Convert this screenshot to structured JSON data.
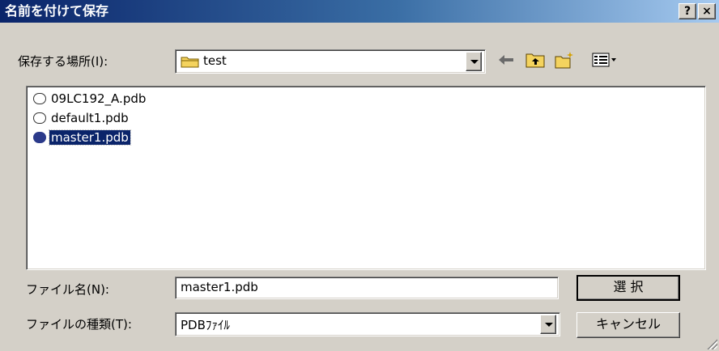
{
  "window": {
    "title": "名前を付けて保存",
    "help_label": "?",
    "close_label": "×"
  },
  "location": {
    "label": "保存する場所(I):",
    "value": "test"
  },
  "files": [
    {
      "name": "09LC192_A.pdb",
      "selected": false
    },
    {
      "name": "default1.pdb",
      "selected": false
    },
    {
      "name": "master1.pdb",
      "selected": true
    }
  ],
  "filename": {
    "label": "ファイル名(N):",
    "value": "master1.pdb"
  },
  "filetype": {
    "label": "ファイルの種類(T):",
    "value": "PDBﾌｧｲﾙ"
  },
  "buttons": {
    "ok": "選 択",
    "cancel": "キャンセル"
  },
  "colors": {
    "title_start": "#0a246a",
    "title_end": "#a6caf0",
    "selection": "#0a246a",
    "face": "#d4d0c8"
  },
  "icons": [
    "folder-icon",
    "back-arrow-icon",
    "up-folder-icon",
    "new-folder-icon",
    "view-menu-icon",
    "pdb-file-icon"
  ]
}
